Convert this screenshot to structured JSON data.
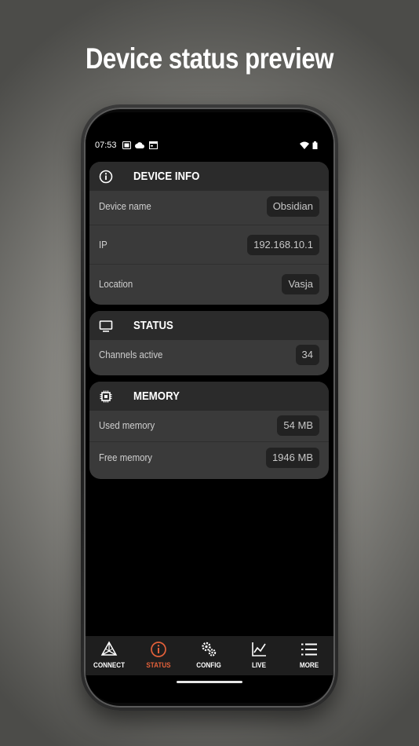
{
  "headline": "Device status preview",
  "status_bar": {
    "time": "07:53"
  },
  "cards": {
    "device_info": {
      "title": "DEVICE INFO",
      "icon": "info-icon",
      "rows": [
        {
          "label": "Device name",
          "value": "Obsidian"
        },
        {
          "label": "IP",
          "value": "192.168.10.1"
        },
        {
          "label": "Location",
          "value": "Vasja"
        }
      ]
    },
    "status": {
      "title": "STATUS",
      "icon": "monitor-icon",
      "rows": [
        {
          "label": "Channels active",
          "value": "34"
        }
      ]
    },
    "memory": {
      "title": "MEMORY",
      "icon": "chip-icon",
      "rows": [
        {
          "label": "Used memory",
          "value": "54 MB"
        },
        {
          "label": "Free memory",
          "value": "1946 MB"
        }
      ]
    }
  },
  "nav": {
    "active": "status",
    "items": [
      {
        "id": "connect",
        "label": "CONNECT",
        "icon": "connect-icon"
      },
      {
        "id": "status",
        "label": "STATUS",
        "icon": "info-icon"
      },
      {
        "id": "config",
        "label": "CONFIG",
        "icon": "gears-icon"
      },
      {
        "id": "live",
        "label": "LIVE",
        "icon": "chart-icon"
      },
      {
        "id": "more",
        "label": "MORE",
        "icon": "list-icon"
      }
    ]
  },
  "colors": {
    "accent": "#e2603a",
    "card_bg": "#3a3a3a",
    "card_header_bg": "#2b2b2b",
    "value_pill_bg": "#222222"
  }
}
